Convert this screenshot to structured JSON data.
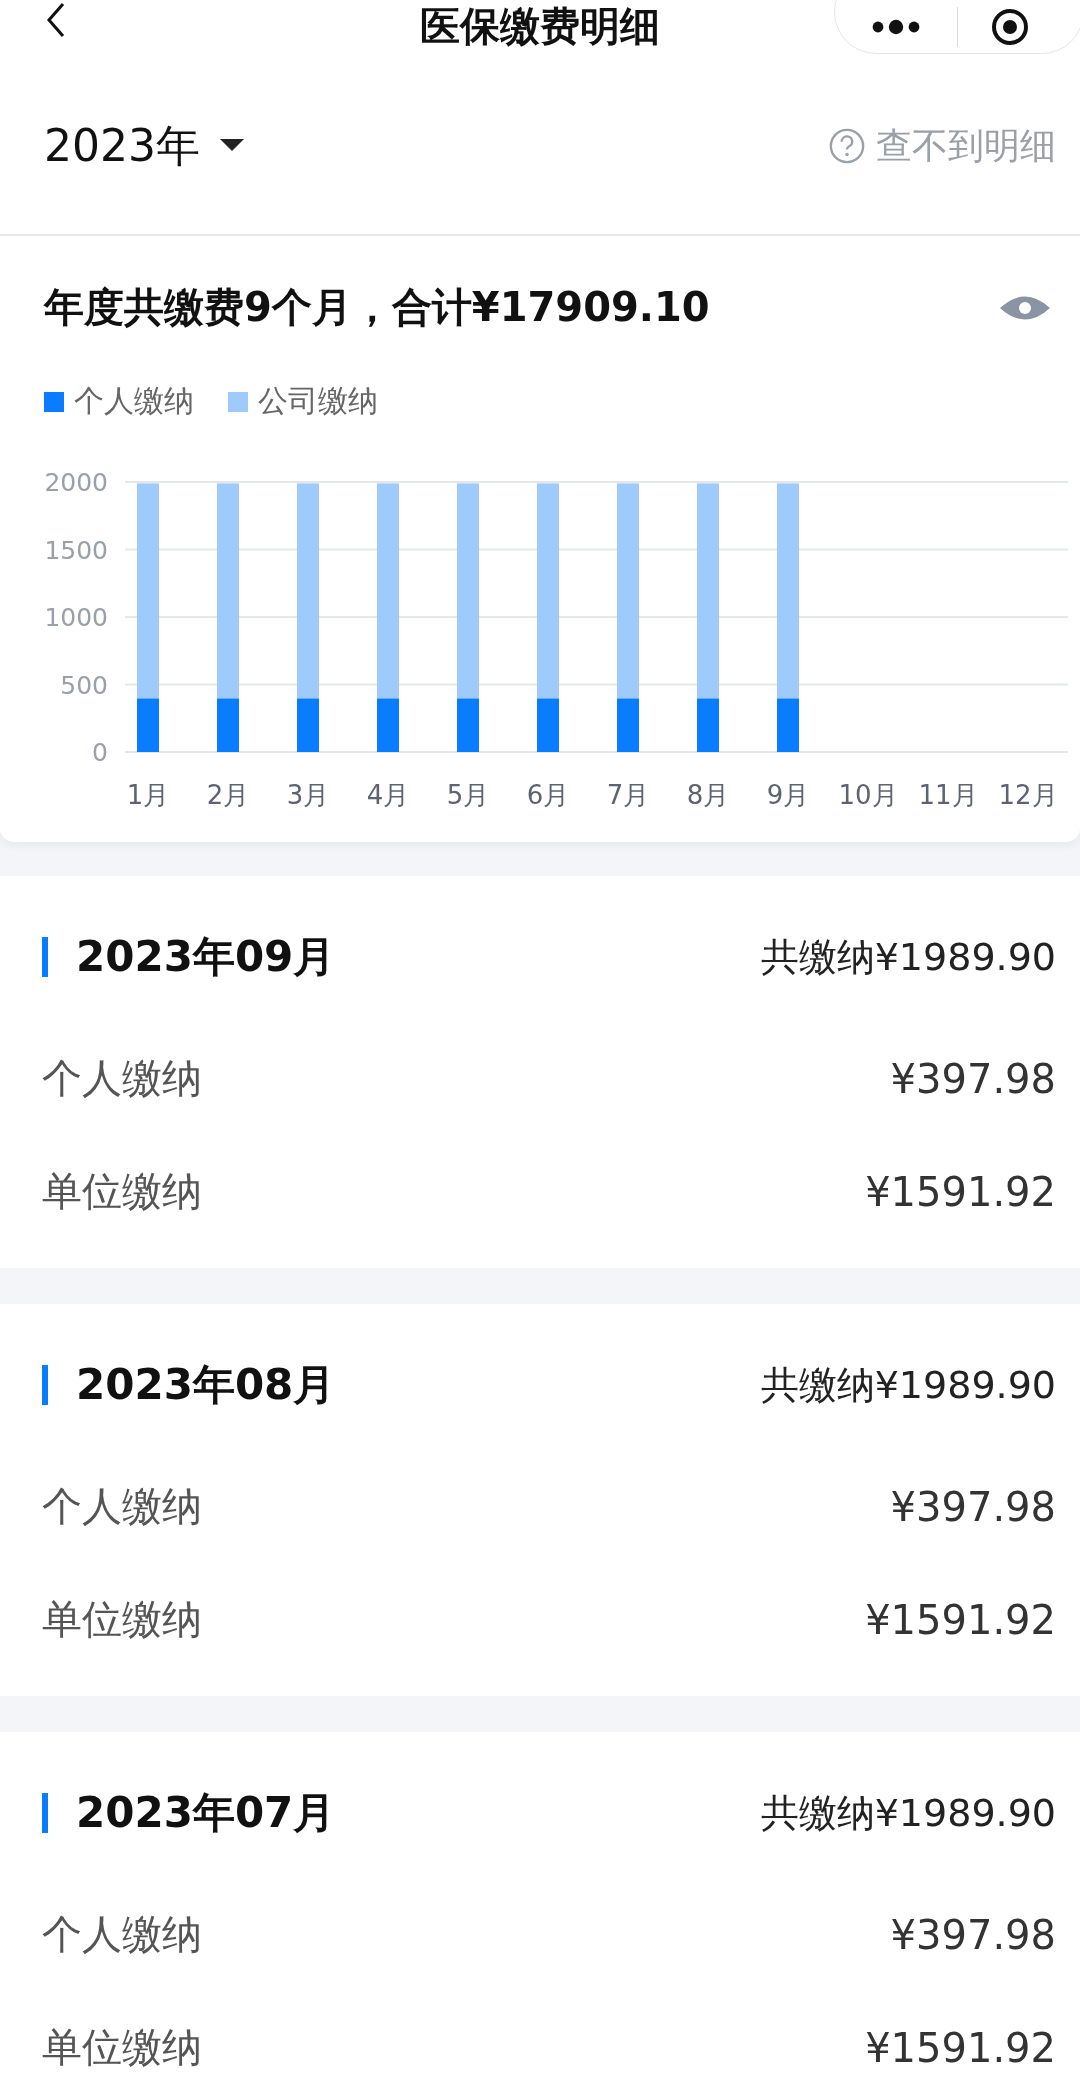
{
  "nav_bar": {
    "title": "医保缴费明细"
  },
  "year_selector": {
    "value": "2023年",
    "help_link": "查不到明细"
  },
  "summary": {
    "title": "年度共缴费9个月，合计¥17909.10",
    "chart_data": {
      "type": "bar",
      "stacked": true,
      "grid": true,
      "categories": [
        "1月",
        "2月",
        "3月",
        "4月",
        "5月",
        "6月",
        "7月",
        "8月",
        "9月",
        "10月",
        "11月",
        "12月"
      ],
      "ylim": [
        0,
        2000
      ],
      "yticks": [
        0,
        500,
        1000,
        1500,
        2000
      ],
      "series": [
        {
          "name": "个人缴纳",
          "color": "#0a7cff",
          "values": [
            398,
            398,
            398,
            398,
            398,
            398,
            398,
            398,
            398,
            null,
            null,
            null
          ]
        },
        {
          "name": "公司缴纳",
          "color": "#9fcbfc",
          "values": [
            1592,
            1592,
            1592,
            1592,
            1592,
            1592,
            1592,
            1592,
            1592,
            null,
            null,
            null
          ]
        }
      ]
    }
  },
  "months": [
    {
      "month": "2023年09月",
      "total": "共缴纳¥1989.90",
      "rows": [
        {
          "label": "个人缴纳",
          "amount": "¥397.98"
        },
        {
          "label": "单位缴纳",
          "amount": "¥1591.92"
        }
      ]
    },
    {
      "month": "2023年08月",
      "total": "共缴纳¥1989.90",
      "rows": [
        {
          "label": "个人缴纳",
          "amount": "¥397.98"
        },
        {
          "label": "单位缴纳",
          "amount": "¥1591.92"
        }
      ]
    },
    {
      "month": "2023年07月",
      "total": "共缴纳¥1989.90",
      "rows": [
        {
          "label": "个人缴纳",
          "amount": "¥397.98"
        },
        {
          "label": "单位缴纳",
          "amount": "¥1591.92"
        }
      ]
    }
  ]
}
